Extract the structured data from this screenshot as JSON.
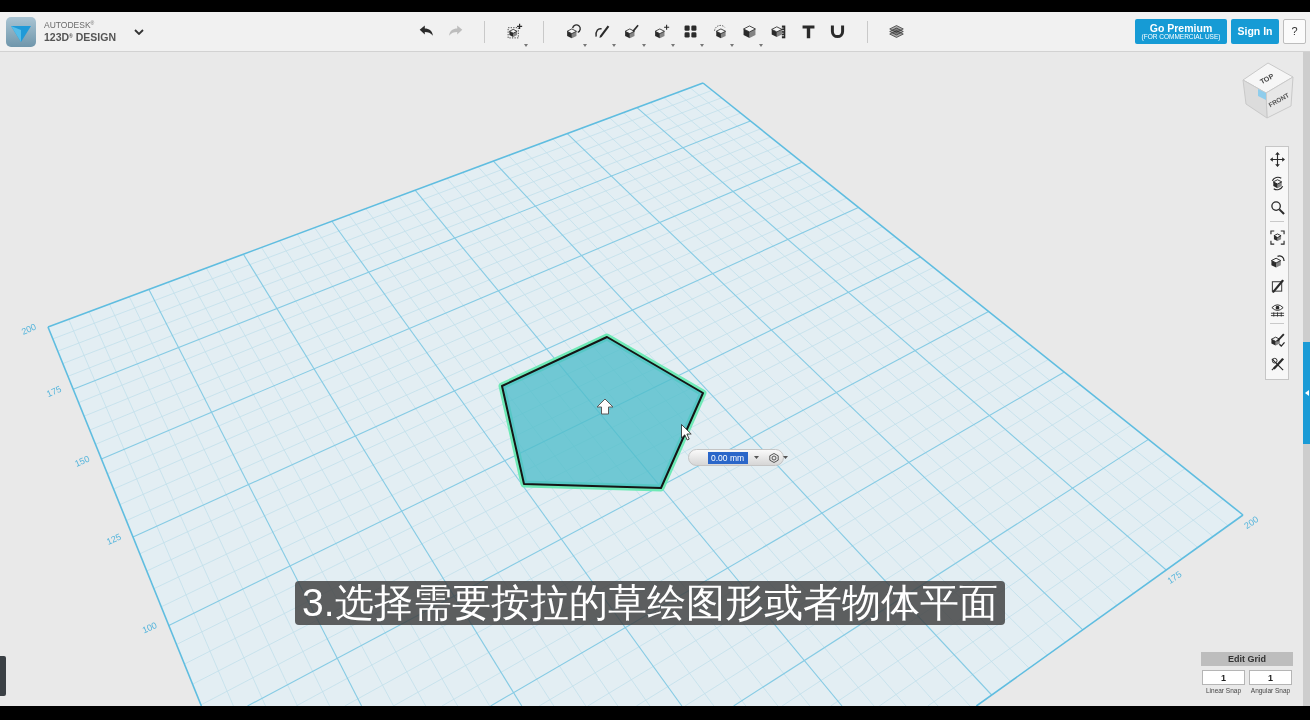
{
  "header": {
    "brand_top": "AUTODESK$^{®}$",
    "brand_name": "123D$^{®}$ DESIGN",
    "toolbar": {
      "groups": [
        [
          {
            "disabled": false,
            "menu": false
          },
          {
            "disabled": true,
            "menu": false
          }
        ],
        [
          {
            "disabled": false,
            "menu": true
          }
        ],
        [
          {
            "disabled": false,
            "menu": true
          },
          {
            "disabled": false,
            "menu": true
          },
          {
            "disabled": false,
            "menu": true
          },
          {
            "disabled": false,
            "menu": true
          },
          {
            "disabled": false,
            "menu": true
          },
          {
            "disabled": false,
            "menu": true
          },
          {
            "disabled": false,
            "menu": true
          },
          {
            "disabled": false,
            "menu": false
          },
          {
            "disabled": false,
            "menu": false
          },
          {
            "disabled": false,
            "menu": false
          }
        ],
        [
          {
            "disabled": false,
            "menu": false
          }
        ]
      ]
    },
    "buttons": [
      {
        "kind": "primary",
        "label": "Go Premium",
        "sublabel": "(FOR COMMERCIAL USE)"
      },
      {
        "kind": "primary",
        "label": "Sign In"
      },
      {
        "kind": "plain",
        "label": "?"
      }
    ]
  },
  "viewport": {
    "grid": {
      "left_labels": [
        "200",
        "175",
        "150",
        "125",
        "100"
      ],
      "right_labels": [
        "200",
        "175"
      ]
    },
    "distance_input": {
      "value": "0.00 mm",
      "highlighted": true
    },
    "view_cube": {
      "top_face": "TOP",
      "front_face": "FRONT"
    },
    "view_toolbar": {
      "groups": [
        [
          {
            "disabled": false
          },
          {
            "disabled": false
          },
          {
            "disabled": false
          }
        ],
        [
          {
            "disabled": false
          },
          {
            "disabled": false
          },
          {
            "disabled": false
          },
          {
            "disabled": false
          }
        ],
        [
          {
            "disabled": false
          },
          {
            "disabled": false
          }
        ]
      ]
    },
    "edit_grid": {
      "title": "Edit Grid",
      "fields": [
        {
          "value": "1",
          "label": "Linear Snap"
        },
        {
          "value": "1",
          "label": "Angular Snap"
        }
      ]
    },
    "caption": "3.选择需要按拉的草绘图形或者物体平面"
  }
}
